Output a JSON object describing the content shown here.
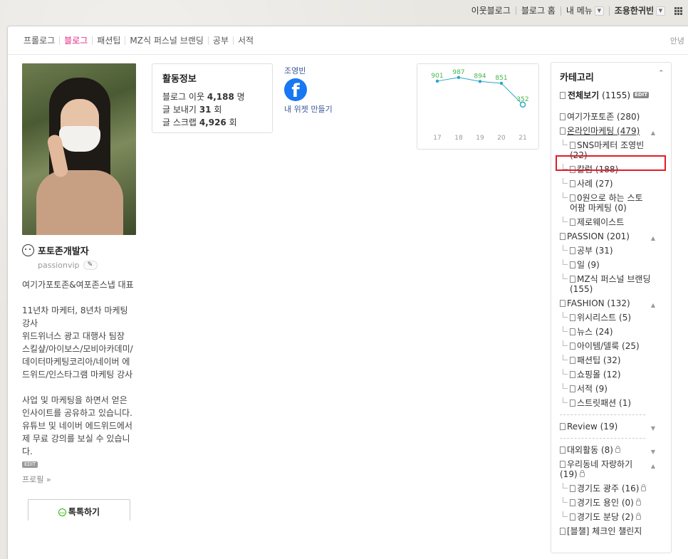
{
  "topbar": {
    "neighbor_blog": "이웃블로그",
    "blog_home": "블로그 홈",
    "my_menu": "내 메뉴",
    "user_name": "조용한귀빈"
  },
  "menu": {
    "items": [
      {
        "label": "프롤로그",
        "active": false
      },
      {
        "label": "블로그",
        "active": true
      },
      {
        "label": "패션팁",
        "active": false
      },
      {
        "label": "MZ식 퍼스널 브랜딩",
        "active": false
      },
      {
        "label": "공부",
        "active": false
      },
      {
        "label": "서적",
        "active": false
      }
    ],
    "right_text": "안녕"
  },
  "profile": {
    "nickname": "포토존개발자",
    "blog_id": "passionvip",
    "bio": "여기가포토존&여포존스냅 대표\n\n11년차 마케터, 8년차 마케팅 강사\n위드위너스 광고 대행사 팀장\n스킬샾/아이보스/모비아카데미/데이터마케팅코리아/네이버 에드위드/인스타그램 마케팅 강사\n\n사업 및 마케팅을 하면서 얻은 인사이트를 공유하고 있습니다. 유튜브 및 네이버 에드위드에서 제 무료 강의를 보실 수 있습니다.",
    "edit_label": "EDIT",
    "profile_link": "프로필 »",
    "talk_button": "톡톡하기"
  },
  "activity": {
    "title": "활동정보",
    "neighbors_label": "블로그 이웃",
    "neighbors_value": "4,188",
    "neighbors_unit": "명",
    "sends_label": "글 보내기",
    "sends_value": "31",
    "sends_unit": "회",
    "scraps_label": "글 스크랩",
    "scraps_value": "4,926",
    "scraps_unit": "회"
  },
  "facebook_widget": {
    "label": "조영빈",
    "make_widget": "내 위젯 만들기"
  },
  "chart_data": {
    "type": "line",
    "x": [
      "17",
      "18",
      "19",
      "20",
      "21"
    ],
    "values": [
      901,
      987,
      894,
      851,
      352
    ],
    "ylim": [
      0,
      1000
    ],
    "color": "#2ba8c8",
    "label_color": "#48b648"
  },
  "category": {
    "title": "카테고리",
    "all_label": "전체보기",
    "all_count": "(1155)",
    "edit_label": "EDIT",
    "items": [
      {
        "label": "여기가포토존 (280)",
        "level": 0
      },
      {
        "label": "온라인마케팅 (479)",
        "level": 0,
        "arrow": "up",
        "highlight": true
      },
      {
        "label": "SNS마케터 조영빈\n(22)",
        "level": 1
      },
      {
        "label": "칼럼 (188)",
        "level": 1
      },
      {
        "label": "사례 (27)",
        "level": 1
      },
      {
        "label": "0원으로 하는 스토\n어팜 마케팅 (0)",
        "level": 1
      },
      {
        "label": "제로웨이스트",
        "level": 1
      },
      {
        "label": "PASSION (201)",
        "level": 0,
        "arrow": "up"
      },
      {
        "label": "공부 (31)",
        "level": 1
      },
      {
        "label": "일 (9)",
        "level": 1
      },
      {
        "label": "MZ식 퍼스널 브랜딩\n(155)",
        "level": 1
      },
      {
        "label": "FASHION (132)",
        "level": 0,
        "arrow": "up"
      },
      {
        "label": "위시리스트 (5)",
        "level": 1
      },
      {
        "label": "뉴스 (24)",
        "level": 1
      },
      {
        "label": "아이템/델룩 (25)",
        "level": 1
      },
      {
        "label": "패션팁 (32)",
        "level": 1
      },
      {
        "label": "쇼핑몰 (12)",
        "level": 1
      },
      {
        "label": "서적 (9)",
        "level": 1
      },
      {
        "label": "스트릿패션 (1)",
        "level": 1
      },
      {
        "divider": true
      },
      {
        "label": "Review (19)",
        "level": 0,
        "arrow": "down"
      },
      {
        "divider": true
      },
      {
        "label": "대외활동 (8)",
        "level": 0,
        "arrow": "down",
        "lock": true
      },
      {
        "label": "우리동네 자랑하기\n(19)",
        "level": 0,
        "arrow": "up",
        "lock": true
      },
      {
        "label": "경기도 광주 (16)",
        "level": 1,
        "lock": true
      },
      {
        "label": "경기도 용인 (0)",
        "level": 1,
        "lock": true
      },
      {
        "label": "경기도 분당 (2)",
        "level": 1,
        "lock": true
      },
      {
        "label": "[블챌] 체크인 챌린지",
        "level": 0
      }
    ]
  }
}
